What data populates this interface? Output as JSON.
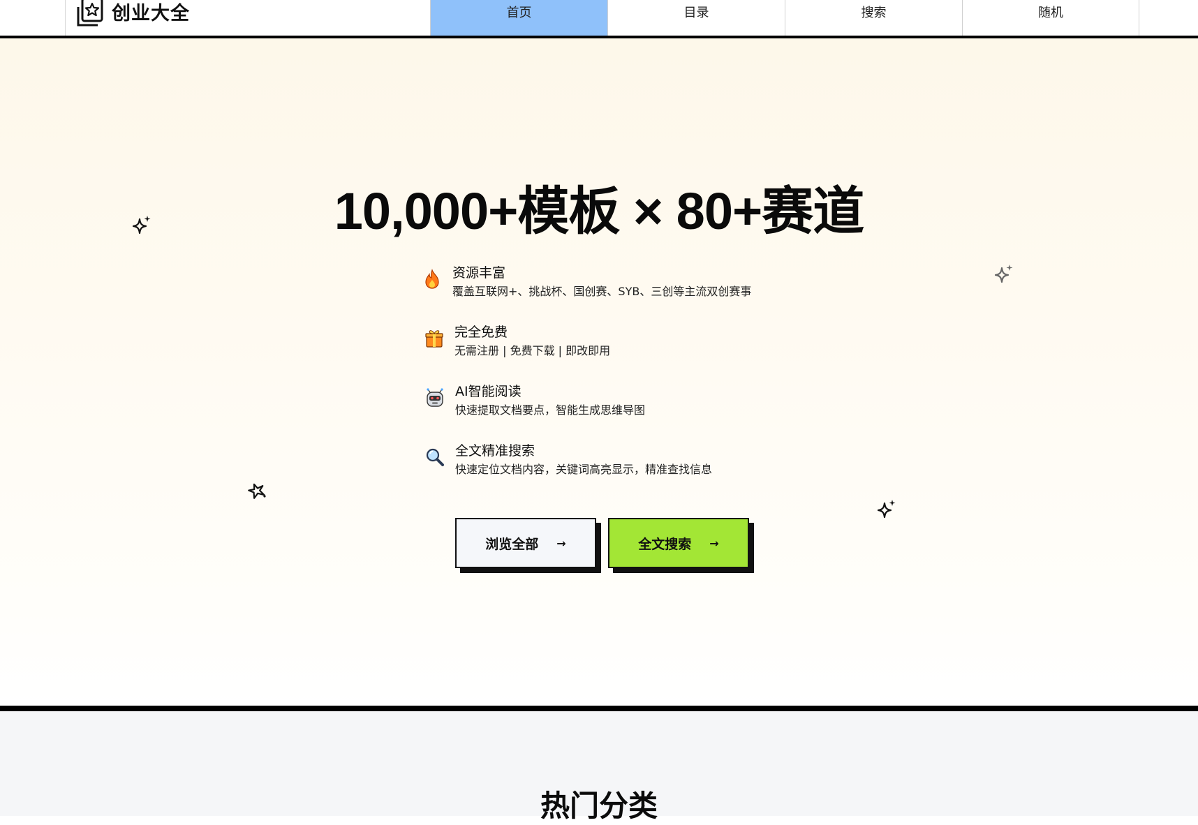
{
  "brand": {
    "name": "创业大全"
  },
  "nav": {
    "items": [
      {
        "label": "首页",
        "active": true
      },
      {
        "label": "目录",
        "active": false
      },
      {
        "label": "搜索",
        "active": false
      },
      {
        "label": "随机",
        "active": false
      }
    ]
  },
  "hero": {
    "title": "10,000+模板 × 80+赛道",
    "features": [
      {
        "icon": "fire-icon",
        "title": "资源丰富",
        "desc": "覆盖互联网+、挑战杯、国创赛、SYB、三创等主流双创赛事"
      },
      {
        "icon": "gift-icon",
        "title": "完全免费",
        "desc": "无需注册 | 免费下载 | 即改即用"
      },
      {
        "icon": "robot-icon",
        "title": "AI智能阅读",
        "desc": "快速提取文档要点，智能生成思维导图"
      },
      {
        "icon": "magnifier-icon",
        "title": "全文精准搜索",
        "desc": "快速定位文档内容，关键词高亮显示，精准查找信息"
      }
    ],
    "buttons": {
      "browse_label": "浏览全部",
      "search_label": "全文搜索",
      "arrow": "→"
    }
  },
  "section": {
    "title": "热门分类"
  },
  "colors": {
    "nav_active": "#8fc1fa",
    "search_button": "#a3e635",
    "browse_button": "#f5f7fa"
  }
}
